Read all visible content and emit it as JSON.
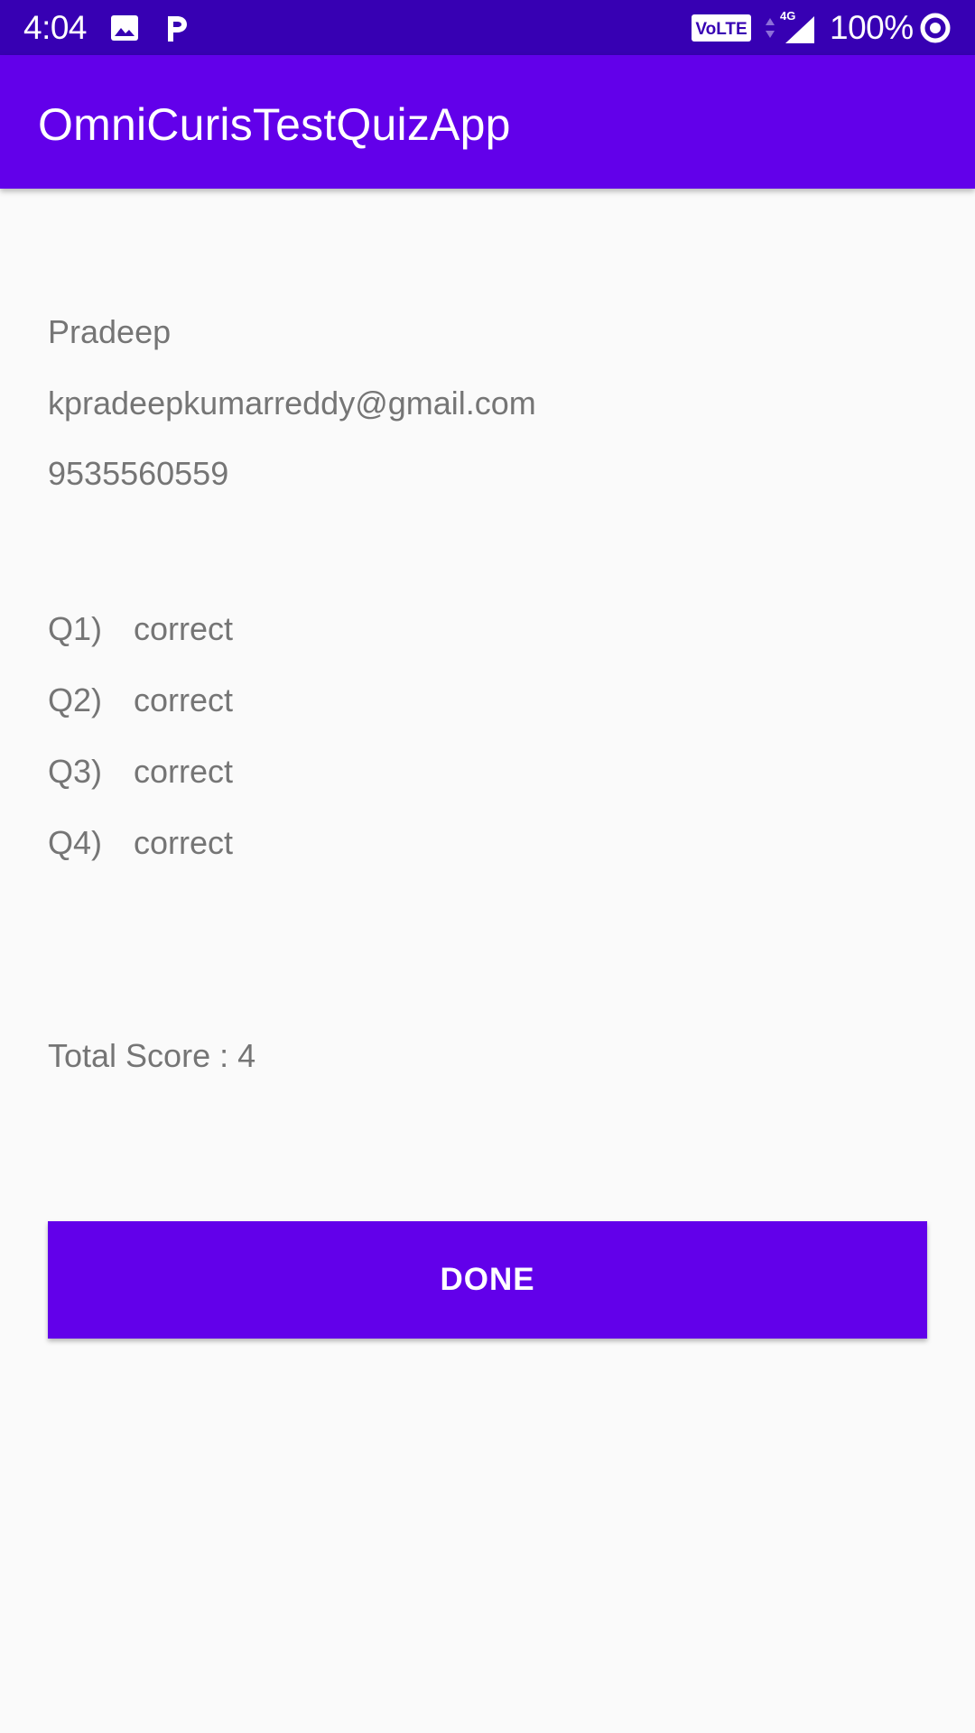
{
  "status_bar": {
    "time": "4:04",
    "battery_percent": "100%",
    "volte_label": "VoLTE",
    "network_label": "4G",
    "icons": [
      "image-icon",
      "parking-icon",
      "volte-icon",
      "signal-icon",
      "sync-icon"
    ]
  },
  "app_bar": {
    "title": "OmniCurisTestQuizApp"
  },
  "user": {
    "name": "Pradeep",
    "email": "kpradeepkumarreddy@gmail.com",
    "phone": "9535560559"
  },
  "results": [
    {
      "question": "Q1)",
      "status": "correct"
    },
    {
      "question": "Q2)",
      "status": "correct"
    },
    {
      "question": "Q3)",
      "status": "correct"
    },
    {
      "question": "Q4)",
      "status": "correct"
    }
  ],
  "total_score": "Total Score : 4",
  "done_button_label": "DONE",
  "colors": {
    "status_bar": "#3700b3",
    "primary": "#6200ea",
    "text_secondary": "#757575",
    "background": "#fafafa"
  }
}
